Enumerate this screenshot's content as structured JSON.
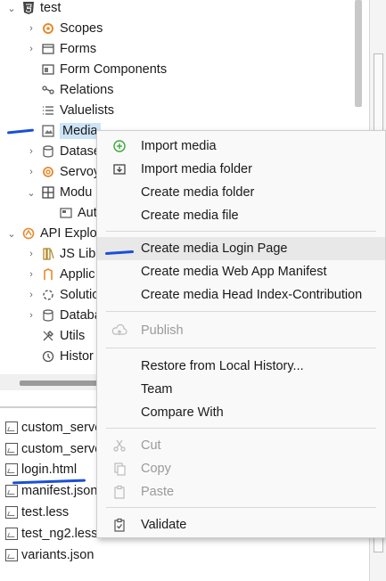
{
  "tree": {
    "root": {
      "label": "test",
      "icon": "html5-icon"
    },
    "items": [
      {
        "label": "Scopes",
        "icon": "scopes-icon"
      },
      {
        "label": "Forms",
        "icon": "forms-icon"
      },
      {
        "label": "Form Components",
        "icon": "form-components-icon"
      },
      {
        "label": "Relations",
        "icon": "relations-icon"
      },
      {
        "label": "Valuelists",
        "icon": "valuelists-icon"
      },
      {
        "label": "Media",
        "icon": "media-icon"
      },
      {
        "label": "Datase",
        "icon": "datasource-icon"
      },
      {
        "label": "Servoy",
        "icon": "servoy-icon"
      },
      {
        "label": "Modu",
        "icon": "modules-icon"
      },
      {
        "label": "Aut",
        "icon": "module-item-icon"
      },
      {
        "label": "API Explor",
        "icon": "api-explorer-icon"
      },
      {
        "label": "JS Lib",
        "icon": "jslib-icon"
      },
      {
        "label": "Applic",
        "icon": "application-icon"
      },
      {
        "label": "Solutio",
        "icon": "solution-icon"
      },
      {
        "label": "Databa",
        "icon": "database-icon"
      },
      {
        "label": "Utils",
        "icon": "utils-icon"
      },
      {
        "label": "Histor",
        "icon": "history-icon"
      }
    ]
  },
  "files": [
    {
      "label": "custom_serve"
    },
    {
      "label": "custom_serve"
    },
    {
      "label": "login.html"
    },
    {
      "label": "manifest.json"
    },
    {
      "label": "test.less"
    },
    {
      "label": "test_ng2.less"
    },
    {
      "label": "variants.json"
    }
  ],
  "menu": {
    "import_media": "Import media",
    "import_media_folder": "Import media folder",
    "create_media_folder": "Create media folder",
    "create_media_file": "Create media file",
    "create_login_page": "Create media Login Page",
    "create_manifest": "Create media Web App Manifest",
    "create_head_index": "Create media Head Index-Contribution",
    "publish": "Publish",
    "restore_history": "Restore from Local History...",
    "team": "Team",
    "compare_with": "Compare With",
    "cut": "Cut",
    "copy": "Copy",
    "paste": "Paste",
    "validate": "Validate"
  },
  "colors": {
    "annotation_mark": "#1a4fd6",
    "selection": "#cce4f7",
    "menu_bg": "#f9f9f9",
    "menu_hover": "#e8e8e8",
    "disabled_text": "#9a9a9a"
  }
}
